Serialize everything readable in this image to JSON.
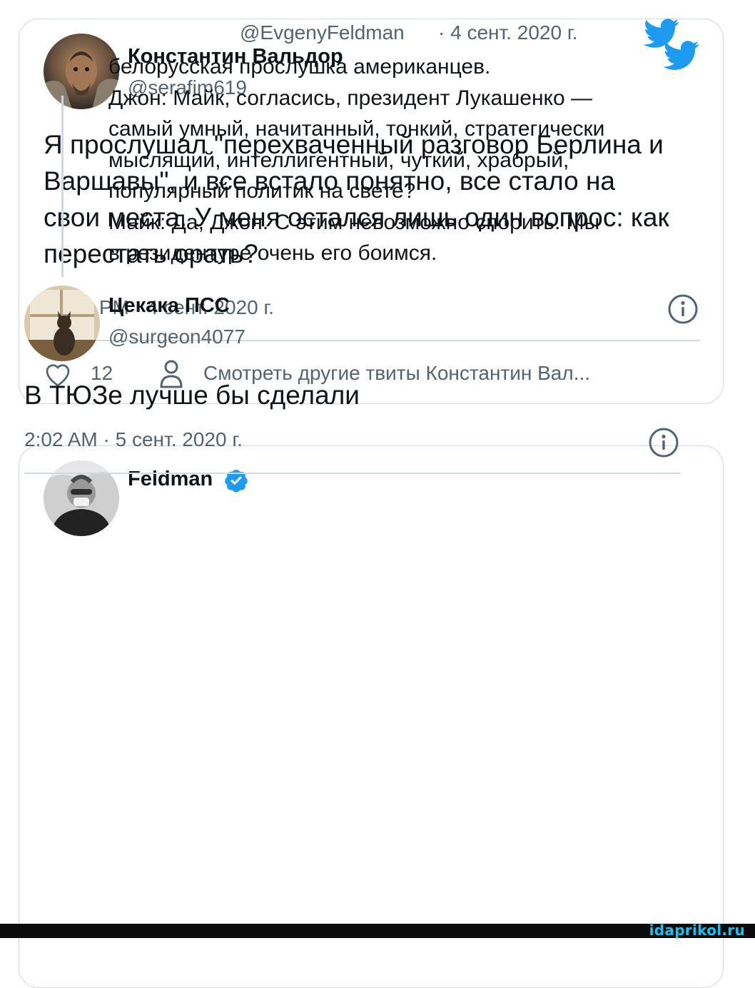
{
  "tweet1": {
    "author_name": "Константин Вальдор",
    "author_handle": "@serafim619",
    "text": "Я прослушал \"перехваченный разговор Берлина и Варшавы\", и все встало понятно, все стало на свои места.  У меня остался лишь один вопрос: как перестать орать?",
    "timestamp": "10:18 PM · 4 сент. 2020 г.",
    "like_count": "12",
    "more_tweets_label": "Смотреть другие твиты Константин Вал...",
    "twitter_icon": "twitter-bird-icon",
    "info_icon": "info-icon",
    "like_icon": "heart-icon",
    "profile_icon": "person-icon"
  },
  "tweet2": {
    "quoted": {
      "author_name": "Feldman",
      "author_handle": "@EvgenyFeldman",
      "date": "· 4 сент. 2020 г.",
      "verified_icon": "verified-badge-icon",
      "lines": [
        "белорусская прослушка американцев.",
        "Джон: Майк, согласись, президент Лукашенко —",
        "самый умный, начитанный, тонкий, стратегически",
        "мыслящий, интеллигентный, чуткий, храбрый,",
        "популярный политик на свете?",
        "Майк: Да, Джон. С этим невозможно спорить. Мы",
        "в резидентуре очень его боимся."
      ]
    },
    "reply": {
      "author_name": "Цекака ПСС",
      "author_handle": "@surgeon4077",
      "text": "В ТЮЗе лучше бы сделали",
      "timestamp": "2:02 AM · 5 сент. 2020 г."
    }
  },
  "watermark": "idaprikol.ru",
  "colors": {
    "twitter_blue": "#1d9bf0",
    "text_primary": "#0f1419",
    "text_secondary": "#536471",
    "border": "#cfd9de",
    "watermark": "#16c2ee"
  }
}
